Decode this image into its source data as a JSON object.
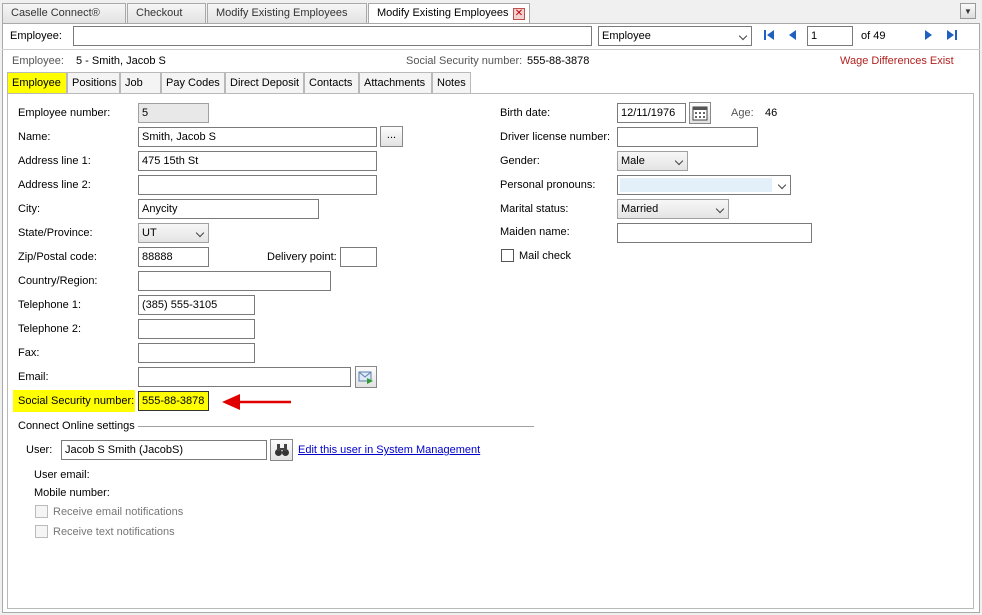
{
  "doc_tabs": [
    {
      "label": "Caselle Connect®"
    },
    {
      "label": "Checkout"
    },
    {
      "label": "Modify Existing Employees"
    },
    {
      "label": "Modify Existing Employees"
    }
  ],
  "lookup": {
    "label": "Employee:",
    "value": "",
    "type_selected": "Employee",
    "record_value": "1",
    "record_total": "of 49"
  },
  "header": {
    "employee_label": "Employee:",
    "employee_value": "5 - Smith, Jacob S",
    "ssn_label": "Social Security number:",
    "ssn_value": "555-88-3878",
    "warning": "Wage Differences Exist",
    "warning_color": "#b22222"
  },
  "sub_tabs": [
    {
      "label": "Employee",
      "active": true
    },
    {
      "label": "Positions"
    },
    {
      "label": "Job"
    },
    {
      "label": "Pay Codes"
    },
    {
      "label": "Direct Deposit"
    },
    {
      "label": "Contacts"
    },
    {
      "label": "Attachments"
    },
    {
      "label": "Notes"
    }
  ],
  "form": {
    "employee_number": {
      "label": "Employee number:",
      "value": "5"
    },
    "name": {
      "label": "Name:",
      "value": "Smith, Jacob S",
      "button": "..."
    },
    "address1": {
      "label": "Address line 1:",
      "value": "475 15th St"
    },
    "address2": {
      "label": "Address line 2:",
      "value": ""
    },
    "city": {
      "label": "City:",
      "value": "Anycity"
    },
    "state": {
      "label": "State/Province:",
      "value": "UT"
    },
    "zip": {
      "label": "Zip/Postal code:",
      "value": "88888"
    },
    "delivery_point": {
      "label": "Delivery point:",
      "value": ""
    },
    "country": {
      "label": "Country/Region:",
      "value": ""
    },
    "telephone1": {
      "label": "Telephone 1:",
      "value": "(385) 555-3105"
    },
    "telephone2": {
      "label": "Telephone 2:",
      "value": ""
    },
    "fax": {
      "label": "Fax:",
      "value": ""
    },
    "email": {
      "label": "Email:",
      "value": ""
    },
    "ssn": {
      "label": "Social Security number:",
      "value": "555-88-3878"
    },
    "birth_date": {
      "label": "Birth date:",
      "value": "12/11/1976"
    },
    "age": {
      "label": "Age:",
      "value": "46"
    },
    "driver_license": {
      "label": "Driver license number:",
      "value": ""
    },
    "gender": {
      "label": "Gender:",
      "value": "Male"
    },
    "pronouns": {
      "label": "Personal pronouns:",
      "value": ""
    },
    "marital": {
      "label": "Marital status:",
      "value": "Married"
    },
    "maiden": {
      "label": "Maiden name:",
      "value": ""
    },
    "mail_check": {
      "label": "Mail check"
    }
  },
  "online": {
    "section_title": "Connect Online settings",
    "user_label": "User:",
    "user_value": "Jacob S Smith (JacobS)",
    "edit_link": "Edit this user in System Management",
    "user_email_label": "User email:",
    "mobile_label": "Mobile number:",
    "email_notif": "Receive email notifications",
    "text_notif": "Receive text notifications"
  },
  "colors": {
    "highlight": "#ffff00",
    "arrow": "#e00000",
    "link": "#0000cc"
  }
}
